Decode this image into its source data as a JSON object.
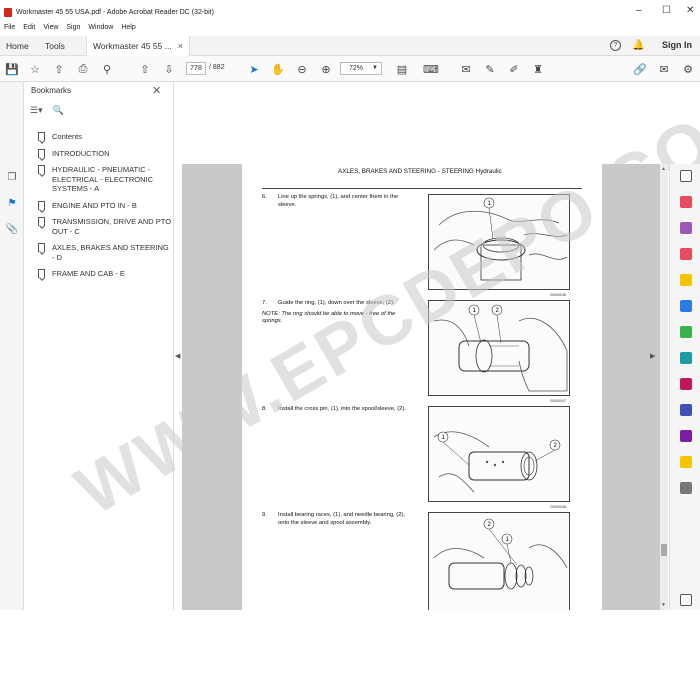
{
  "window": {
    "title": "Workmaster 45 55 USA.pdf - Adobe Acrobat Reader DC (32-bit)",
    "min": "–",
    "max": "☐",
    "close": "✕"
  },
  "menu": [
    "File",
    "Edit",
    "View",
    "Sign",
    "Window",
    "Help"
  ],
  "tabs": {
    "home": "Home",
    "tools": "Tools",
    "document": "Workmaster 45 55 ...",
    "close": "×",
    "help": "?",
    "sign_in": "Sign In"
  },
  "toolbar": {
    "page_current": "778",
    "page_separator": "/",
    "page_total": "882",
    "zoom": "72%"
  },
  "bookmarks": {
    "header": "Bookmarks",
    "close": "✕",
    "items": [
      "Contents",
      "INTRODUCTION",
      "HYDRAULIC - PNEUMATIC - ELECTRICAL - ELECTRONIC SYSTEMS - A",
      "ENGINE AND PTO IN - B",
      "TRANSMISSION, DRIVE AND PTO OUT - C",
      "AXLES, BRAKES AND STEERING - D",
      "FRAME AND CAB - E"
    ]
  },
  "document": {
    "running_header": "AXLES, BRAKES AND STEERING - STEERING Hydraulic",
    "steps": [
      {
        "num": "6.",
        "text": "Line up the springs, (1), and center them in the sleeve.",
        "note": "",
        "fig_code": "00000046"
      },
      {
        "num": "7.",
        "text": "Guide the ring, (1), down over the sleeve, (2).",
        "note": "NOTE: The ring should be able to move - free of the springs.",
        "fig_code": "00000047"
      },
      {
        "num": "8.",
        "text": "Install the cross pin, (1), into the spool/sleeve, (2).",
        "note": "",
        "fig_code": "00000048"
      },
      {
        "num": "9.",
        "text": "Install bearing races, (1), and needle bearing, (2), onto the sleeve and spool assembly.",
        "note": "",
        "fig_code": ""
      }
    ]
  },
  "watermark": "WWW.EPCDEPO.COM",
  "colors": {
    "accent": "#1473e6",
    "app_red": "#d6281e"
  }
}
